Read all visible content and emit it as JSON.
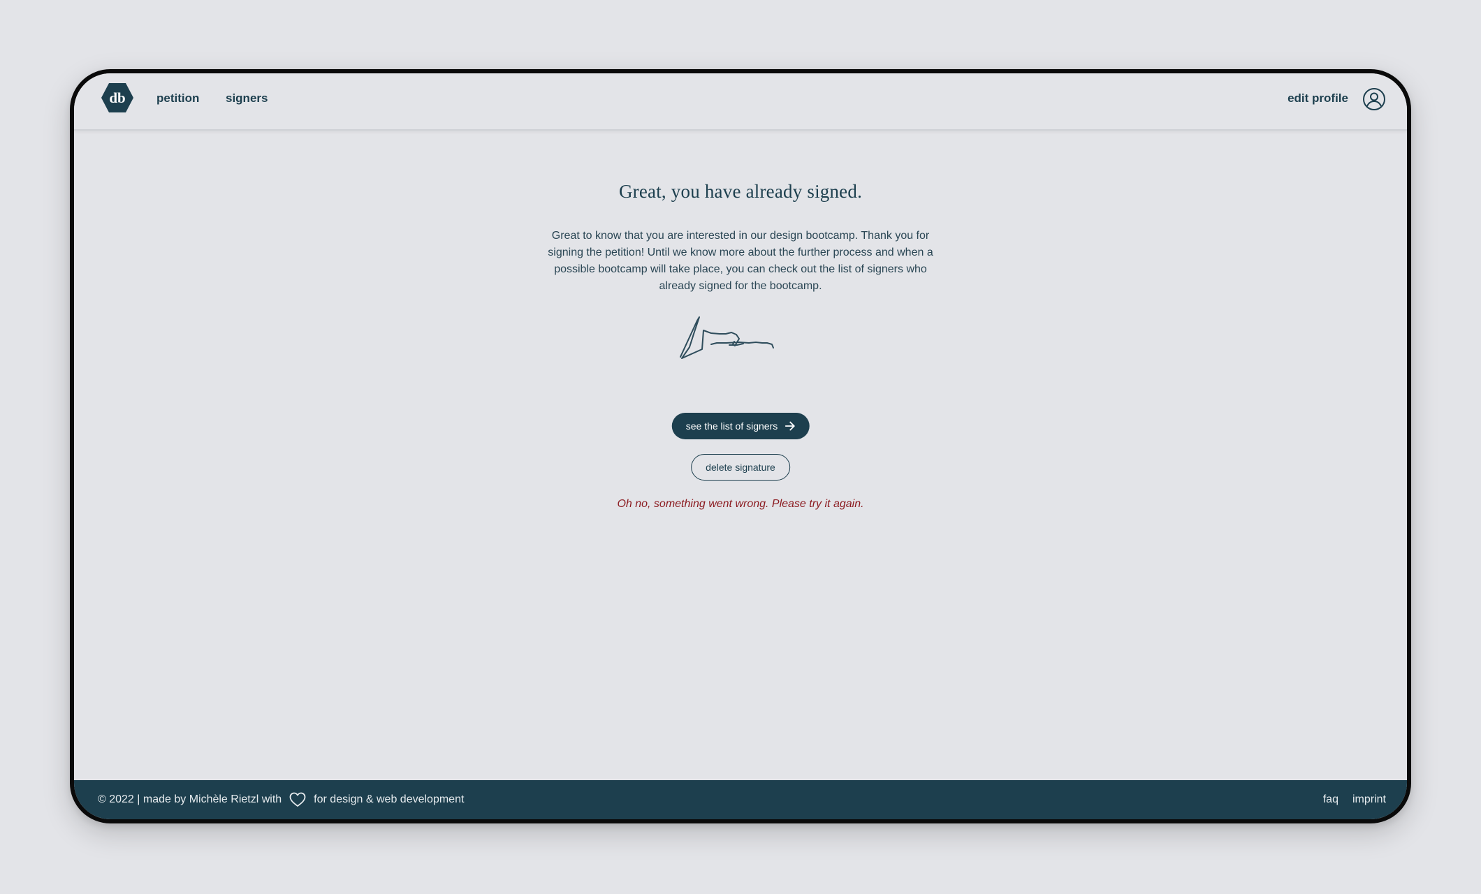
{
  "header": {
    "logo_text": "db",
    "nav": {
      "petition": "petition",
      "signers": "signers"
    },
    "edit_profile": "edit profile",
    "avatar_icon": "user-circle-icon"
  },
  "main": {
    "title": "Great, you have already signed.",
    "intro": "Great to know that you are interested in our design bootcamp. Thank you for signing the petition! Until we know more about the further process and when a possible bootcamp will take place, you can check out the list of signers who already signed for the bootcamp.",
    "signature_icon": "handwritten-signature",
    "see_signers_label": "see the list of signers",
    "see_signers_icon": "arrow-right-icon",
    "delete_label": "delete signature",
    "error_message": "Oh no, something went wrong. Please try it again."
  },
  "footer": {
    "text_before": "© 2022 | made by Michèle Rietzl with",
    "heart_icon": "heart-icon",
    "text_after": "for design & web development",
    "faq": "faq",
    "imprint": "imprint"
  },
  "colors": {
    "brand": "#1d3f4e",
    "background": "#e3e4e8",
    "error": "#8b1a1f"
  }
}
